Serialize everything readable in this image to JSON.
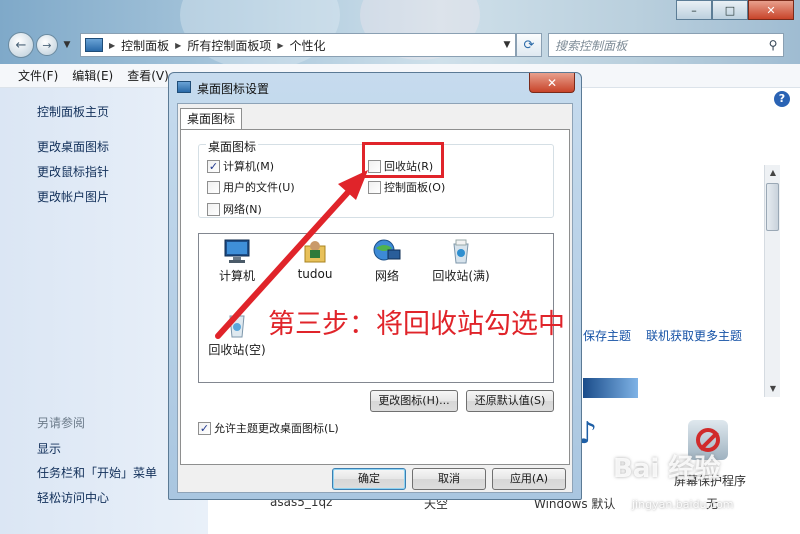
{
  "explorer": {
    "nav": {
      "back": "←",
      "forward": "→",
      "history_drop": "▼",
      "refresh": "⟳"
    },
    "breadcrumbs": [
      "控制面板",
      "所有控制面板项",
      "个性化"
    ],
    "search_placeholder": "搜索控制面板",
    "menu": [
      "文件(F)",
      "编辑(E)",
      "查看(V)"
    ],
    "left_links_top": [
      "控制面板主页",
      "更改桌面图标",
      "更改鼠标指针",
      "更改帐户图片"
    ],
    "see_also_title": "另请参阅",
    "left_links_bottom": [
      "显示",
      "任务栏和「开始」菜单",
      "轻松访问中心"
    ],
    "save_theme": "保存主题",
    "more_themes": "联机获取更多主题",
    "screensaver_label": "屏幕保护程序",
    "screensaver_value": "无",
    "theme_names": [
      "asas5_1qz",
      "天空",
      "Windows 默认"
    ],
    "help_glyph": "?"
  },
  "dialog": {
    "title": "桌面图标设置",
    "close_glyph": "✕",
    "tab": "桌面图标",
    "group_title": "桌面图标",
    "checkboxes": [
      {
        "label": "计算机(M)",
        "checked": true
      },
      {
        "label": "回收站(R)",
        "checked": false
      },
      {
        "label": "用户的文件(U)",
        "checked": false
      },
      {
        "label": "控制面板(O)",
        "checked": false
      },
      {
        "label": "网络(N)",
        "checked": false
      }
    ],
    "check_mark": "✓",
    "preview_icons": [
      "计算机",
      "tudou",
      "网络",
      "回收站(满)",
      "回收站(空)"
    ],
    "change_icon_button": "更改图标(H)...",
    "restore_default_button": "还原默认值(S)",
    "allow_themes_label": "允许主题更改桌面图标(L)",
    "allow_themes_checked": true,
    "ok_button": "确定",
    "cancel_button": "取消",
    "apply_button": "应用(A)"
  },
  "annotation": "第三步：将回收站勾选中",
  "watermark": {
    "brand": "Bai 经验",
    "url": "jingyan.baidu.com"
  },
  "colors": {
    "annotation_red": "#e0242a",
    "link_blue": "#1552a6",
    "dialog_frame": "#a9c6e0"
  }
}
